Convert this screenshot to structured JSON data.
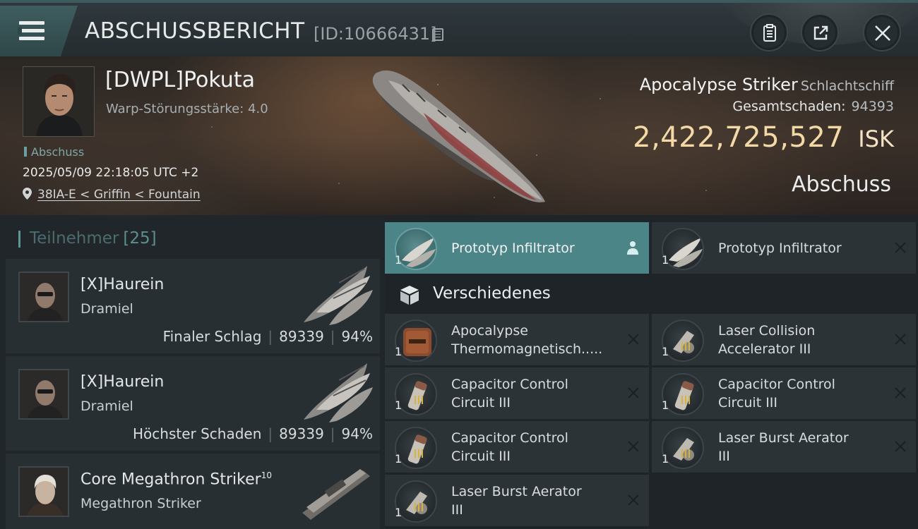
{
  "header": {
    "title": "ABSCHUSSBERICHT",
    "id": "[ID:10666431]",
    "accent": "#3f5d5f"
  },
  "victim": {
    "name": "[DWPL]Pokuta",
    "warp_strength": "Warp-Störungsstärke: 4.0",
    "tag": "Abschuss",
    "datetime": "2025/05/09 22:18:05 UTC +2",
    "location": "38IA-E < Griffin < Fountain",
    "ship": "Apocalypse Striker",
    "ship_class": "Schlachtschiff",
    "damage_label": "Gesamtschaden:",
    "damage_value": "94393",
    "isk_value": "2,422,725,527",
    "isk_unit": "ISK",
    "status": "Abschuss"
  },
  "participants": {
    "title": "Teilnehmer",
    "count": "[25]",
    "rows": [
      {
        "name": "[X]Haurein",
        "ship": "Dramiel",
        "label": "Finaler Schlag",
        "damage": "89339",
        "percent": "94%"
      },
      {
        "name": "[X]Haurein",
        "ship": "Dramiel",
        "label": "Höchster Schaden",
        "damage": "89339",
        "percent": "94%"
      },
      {
        "name": "Core Megathron Striker",
        "level": "10",
        "ship": "Megathron Striker"
      }
    ]
  },
  "items": {
    "top": [
      {
        "name": "Prototyp Infiltrator",
        "qty": "1",
        "selected": true
      },
      {
        "name": "Prototyp Infiltrator",
        "qty": "1"
      }
    ],
    "section_title": "Verschiedenes",
    "misc": [
      {
        "line1": "Apocalypse",
        "line2": "Thermomagnetisch.....",
        "qty": "1"
      },
      {
        "line1": "Laser Collision",
        "line2": "Accelerator III",
        "qty": "1"
      },
      {
        "line1": "Capacitor Control",
        "line2": "Circuit III",
        "qty": "1"
      },
      {
        "line1": "Capacitor Control",
        "line2": "Circuit III",
        "qty": "1"
      },
      {
        "line1": "Capacitor Control",
        "line2": "Circuit III",
        "qty": "1"
      },
      {
        "line1": "Laser Burst Aerator",
        "line2": "III",
        "qty": "1"
      },
      {
        "line1": "Laser Burst Aerator",
        "line2": "III",
        "qty": "1"
      }
    ]
  }
}
